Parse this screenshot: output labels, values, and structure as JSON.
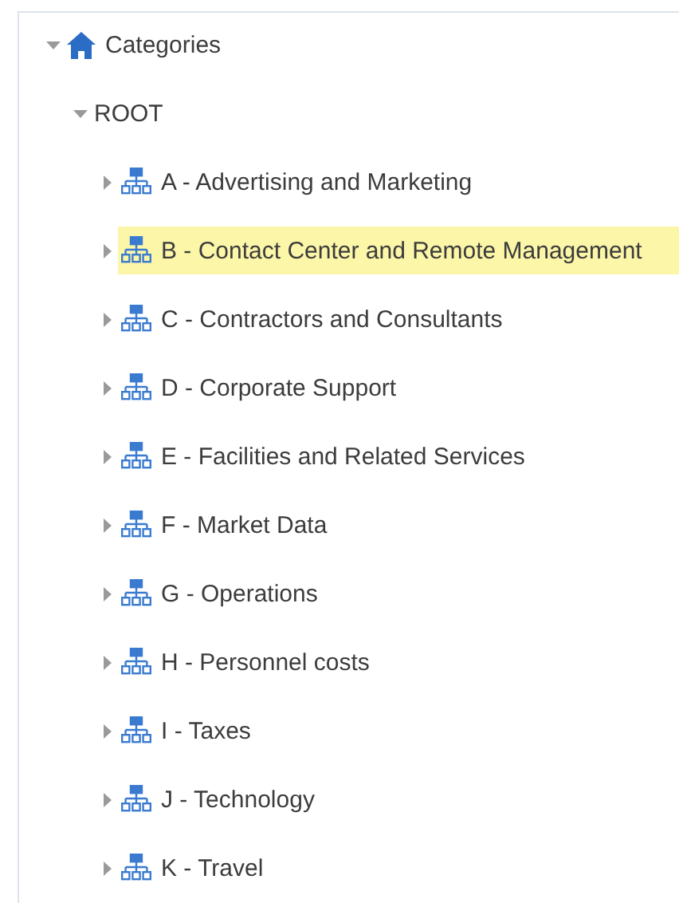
{
  "tree": [
    {
      "label": "Categories",
      "kind": "home",
      "expanded": true,
      "selected": false,
      "children": [
        {
          "label": "ROOT",
          "expanded": true,
          "selected": false,
          "children": [
            {
              "label": "A - Advertising and Marketing",
              "kind": "category",
              "expanded": false,
              "selected": false
            },
            {
              "label": "B - Contact Center and Remote Management",
              "kind": "category",
              "expanded": false,
              "selected": true
            },
            {
              "label": "C - Contractors and Consultants",
              "kind": "category",
              "expanded": false,
              "selected": false
            },
            {
              "label": "D - Corporate Support",
              "kind": "category",
              "expanded": false,
              "selected": false
            },
            {
              "label": "E - Facilities and Related Services",
              "kind": "category",
              "expanded": false,
              "selected": false
            },
            {
              "label": "F - Market Data",
              "kind": "category",
              "expanded": false,
              "selected": false
            },
            {
              "label": "G - Operations",
              "kind": "category",
              "expanded": false,
              "selected": false
            },
            {
              "label": "H - Personnel costs",
              "kind": "category",
              "expanded": false,
              "selected": false
            },
            {
              "label": "I - Taxes",
              "kind": "category",
              "expanded": false,
              "selected": false
            },
            {
              "label": "J - Technology",
              "kind": "category",
              "expanded": false,
              "selected": false
            },
            {
              "label": "K - Travel",
              "kind": "category",
              "expanded": false,
              "selected": false
            }
          ]
        }
      ]
    }
  ]
}
